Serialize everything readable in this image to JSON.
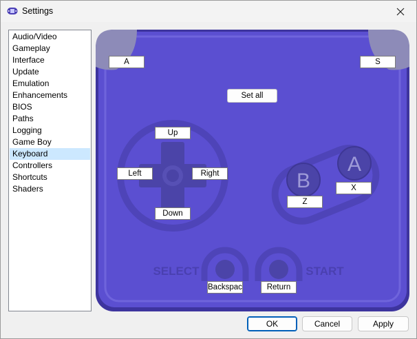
{
  "window": {
    "title": "Settings",
    "app_icon": "gba-icon",
    "close_icon": "close-icon"
  },
  "sidebar": {
    "items": [
      {
        "label": "Audio/Video"
      },
      {
        "label": "Gameplay"
      },
      {
        "label": "Interface"
      },
      {
        "label": "Update"
      },
      {
        "label": "Emulation"
      },
      {
        "label": "Enhancements"
      },
      {
        "label": "BIOS"
      },
      {
        "label": "Paths"
      },
      {
        "label": "Logging"
      },
      {
        "label": "Game Boy"
      },
      {
        "label": "Keyboard"
      },
      {
        "label": "Controllers"
      },
      {
        "label": "Shortcuts"
      },
      {
        "label": "Shaders"
      }
    ],
    "selected": "Keyboard"
  },
  "keyboard": {
    "set_all_label": "Set all",
    "bindings": {
      "l": "A",
      "r": "S",
      "up": "Up",
      "left": "Left",
      "right": "Right",
      "down": "Down",
      "b": "Z",
      "a": "X",
      "select": "Backspace",
      "start": "Return"
    },
    "labels": {
      "select": "SELECT",
      "start": "START",
      "b": "B",
      "a": "A"
    }
  },
  "buttons": {
    "ok": "OK",
    "cancel": "Cancel",
    "apply": "Apply"
  },
  "colors": {
    "body": "#5b4fd1",
    "dark": "#3d349e",
    "button": "#4b44a8",
    "selection": "#cce8ff",
    "shoulder": "#8d8bb8"
  }
}
